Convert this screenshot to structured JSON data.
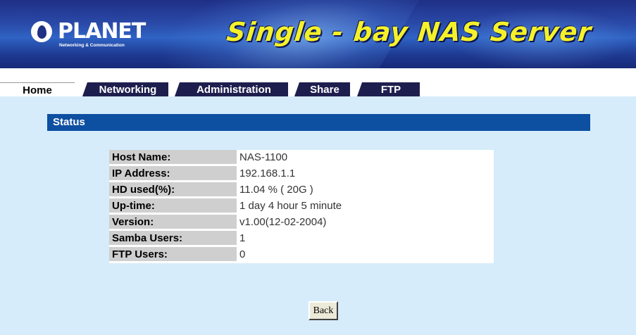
{
  "header": {
    "logo_word": "PLANET",
    "logo_tagline": "Networking & Communication",
    "title": "Single - bay NAS Server"
  },
  "tabs": [
    {
      "label": "Home"
    },
    {
      "label": "Networking"
    },
    {
      "label": "Administration"
    },
    {
      "label": "Share"
    },
    {
      "label": "FTP"
    }
  ],
  "status": {
    "title": "Status",
    "rows": [
      {
        "label": "Host Name:",
        "value": "NAS-1100"
      },
      {
        "label": "IP Address:",
        "value": "192.168.1.1"
      },
      {
        "label": "HD used(%):",
        "value": "11.04 % ( 20G )"
      },
      {
        "label": "Up-time:",
        "value": "1 day 4 hour 5 minute"
      },
      {
        "label": "Version:",
        "value": "v1.00(12-02-2004)"
      },
      {
        "label": "Samba Users:",
        "value": "1"
      },
      {
        "label": "FTP Users:",
        "value": "0"
      }
    ]
  },
  "back_button": {
    "label": "Back"
  },
  "colors": {
    "page_bg": "#d6ecfb",
    "status_bar": "#0d4fa1",
    "tab_bg": "#1e1e4e",
    "banner_title": "#f4f12a"
  },
  "icons": {
    "logo": "planet-logo-icon"
  }
}
